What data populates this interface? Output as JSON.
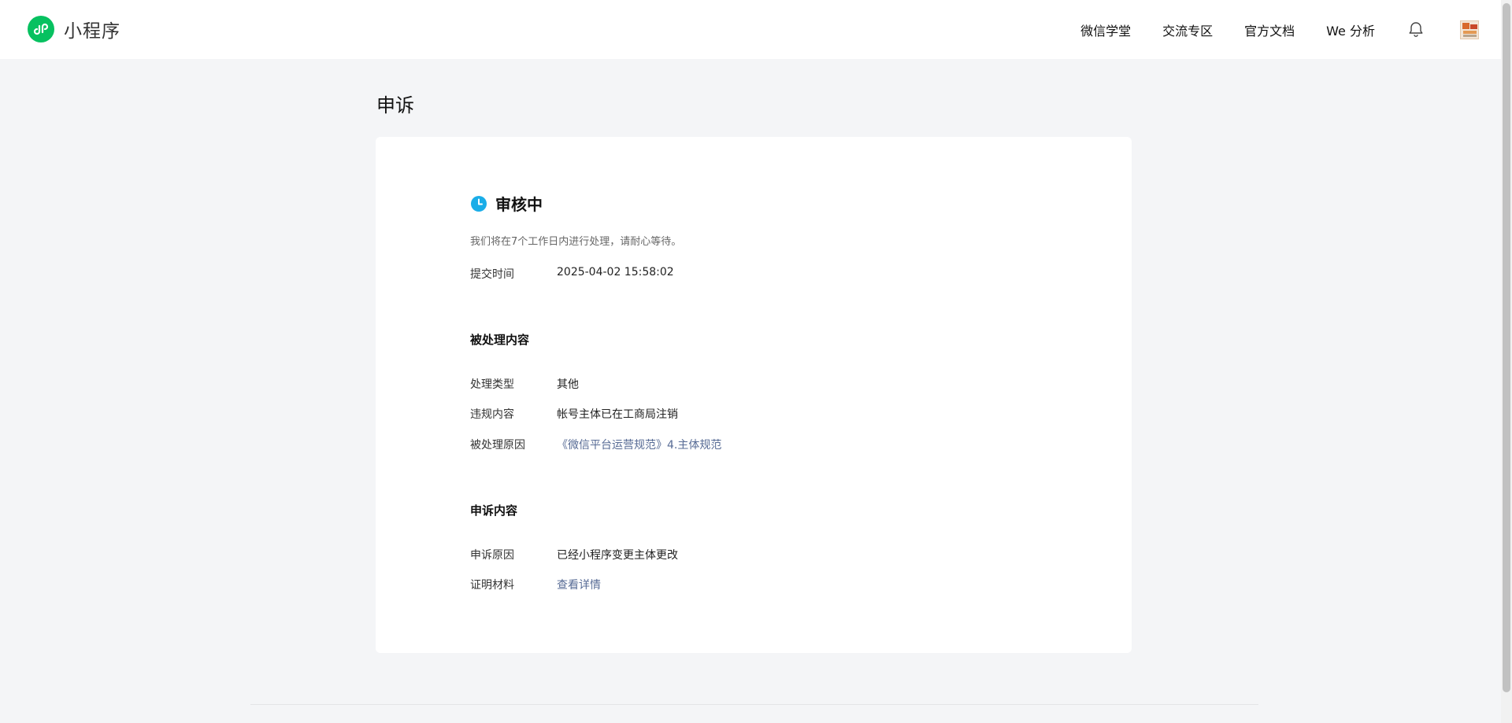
{
  "header": {
    "brand_name": "小程序",
    "nav": [
      "微信学堂",
      "交流专区",
      "官方文档",
      "We 分析"
    ]
  },
  "page": {
    "title": "申诉"
  },
  "status": {
    "label": "审核中",
    "description": "我们将在7个工作日内进行处理，请耐心等待。",
    "submit_time_label": "提交时间",
    "submit_time_value": "2025-04-02 15:58:02"
  },
  "processed_section": {
    "title": "被处理内容",
    "rows": [
      {
        "label": "处理类型",
        "value": "其他"
      },
      {
        "label": "违规内容",
        "value": "帐号主体已在工商局注销"
      },
      {
        "label": "被处理原因",
        "value": "《微信平台运营规范》4.主体规范"
      }
    ]
  },
  "appeal_section": {
    "title": "申诉内容",
    "rows": [
      {
        "label": "申诉原因",
        "value": "已经小程序变更主体更改"
      },
      {
        "label": "证明材料",
        "value": "查看详情"
      }
    ]
  },
  "colors": {
    "accent_green": "#07c160",
    "status_blue": "#1aade8",
    "link_blue": "#576b95",
    "background": "#f4f5f7"
  },
  "icons": {
    "logo": "miniprogram-logo-icon",
    "bell": "bell-icon",
    "status": "clock-icon"
  }
}
